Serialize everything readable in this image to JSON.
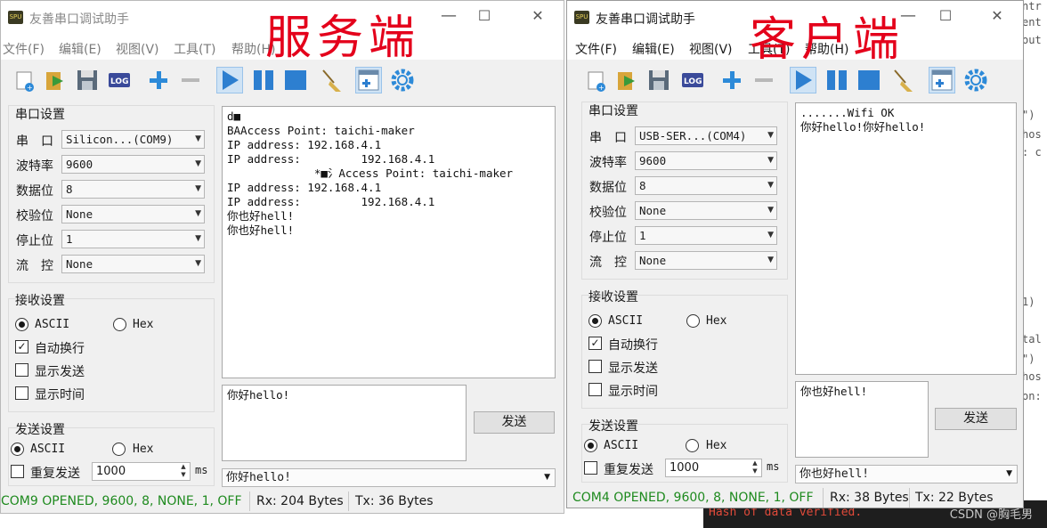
{
  "colors": {
    "status_ok": "#1e8a1e",
    "annotation": "#e4001b",
    "console_error": "#e04a3a",
    "pressed": "#cfe3f5"
  },
  "background": {
    "console_message": "Hash of data verified.",
    "watermark": "CSDN @胸毛男"
  },
  "annotations": {
    "server": "服务端",
    "client": "客户端"
  },
  "server": {
    "title": "友善串口调试助手",
    "minimize": "—",
    "maximize": "☐",
    "close": "✕",
    "menu": [
      "文件(F)",
      "编辑(E)",
      "视图(V)",
      "工具(T)",
      "帮助(H)"
    ],
    "serial_group": "串口设置",
    "serial": {
      "port_label": "串　口",
      "port_value": "Silicon...(COM9)",
      "baud_label": "波特率",
      "baud_value": "9600",
      "data_label": "数据位",
      "data_value": "8",
      "parity_label": "校验位",
      "parity_value": "None",
      "stop_label": "停止位",
      "stop_value": "1",
      "flow_label": "流　控",
      "flow_value": "None"
    },
    "recv_group": "接收设置",
    "recv": {
      "ascii": "ASCII",
      "hex": "Hex",
      "autowrap": "自动换行",
      "show_send": "显示发送",
      "show_time": "显示时间"
    },
    "send_group": "发送设置",
    "send": {
      "ascii": "ASCII",
      "hex": "Hex",
      "repeat": "重复发送",
      "interval": "1000",
      "unit": "ms"
    },
    "receive_lines": [
      "d■",
      "BAAccess Point: taichi-maker",
      "IP address: 192.168.4.1",
      "IP address:         192.168.4.1",
      "             *■氵Access Point: taichi-maker",
      "IP address: 192.168.4.1",
      "IP address:         192.168.4.1",
      "你也好hell!",
      "你也好hell!"
    ],
    "send_text": "你好hello!",
    "send_button": "发送",
    "history": "你好hello!",
    "status_port": "COM9 OPENED, 9600, 8, NONE, 1, OFF",
    "status_rx": "Rx: 204 Bytes",
    "status_tx": "Tx: 36 Bytes"
  },
  "client": {
    "title": "友善串口调试助手",
    "minimize": "—",
    "maximize": "☐",
    "close": "✕",
    "menu": [
      "文件(F)",
      "编辑(E)",
      "视图(V)",
      "工具(T)",
      "帮助(H)"
    ],
    "serial_group": "串口设置",
    "serial": {
      "port_label": "串　口",
      "port_value": "USB-SER...(COM4)",
      "baud_label": "波特率",
      "baud_value": "9600",
      "data_label": "数据位",
      "data_value": "8",
      "parity_label": "校验位",
      "parity_value": "None",
      "stop_label": "停止位",
      "stop_value": "1",
      "flow_label": "流　控",
      "flow_value": "None"
    },
    "recv_group": "接收设置",
    "recv": {
      "ascii": "ASCII",
      "hex": "Hex",
      "autowrap": "自动换行",
      "show_send": "显示发送",
      "show_time": "显示时间"
    },
    "send_group": "发送设置",
    "send": {
      "ascii": "ASCII",
      "hex": "Hex",
      "repeat": "重复发送",
      "interval": "1000",
      "unit": "ms"
    },
    "receive_lines": [
      ".......Wifi OK",
      "你好hello!你好hello!"
    ],
    "send_text": "你也好hell!",
    "send_button": "发送",
    "history": "你也好hell!",
    "status_port": "COM4 OPENED, 9600, 8, NONE, 1, OFF",
    "status_rx": "Rx: 38 Bytes",
    "status_tx": "Tx: 22 Bytes"
  }
}
